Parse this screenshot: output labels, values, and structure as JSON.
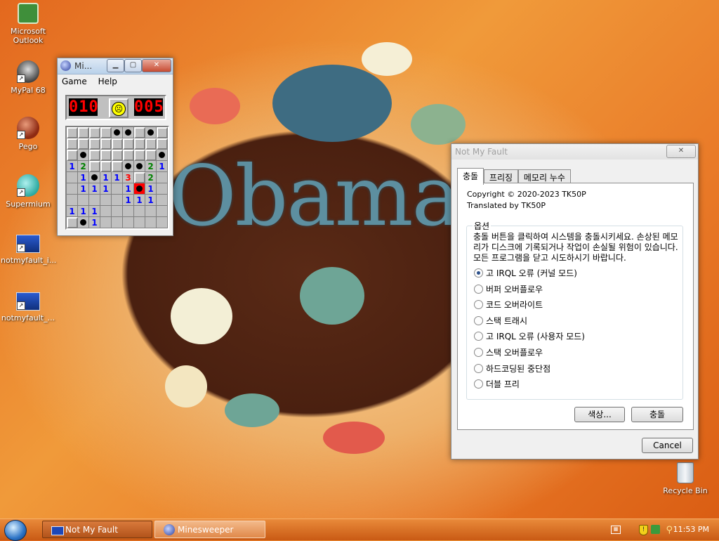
{
  "desktop": {
    "icons": [
      {
        "label": "Microsoft Outlook",
        "icon": "outlook-icon"
      },
      {
        "label": "MyPal 68",
        "icon": "mypal-icon"
      },
      {
        "label": "Pego",
        "icon": "pego-icon"
      },
      {
        "label": "Supermium",
        "icon": "supermium-icon"
      },
      {
        "label": "notmyfault_i...",
        "icon": "notmyfault-icon"
      },
      {
        "label": "notmyfault_...",
        "icon": "notmyfault-icon"
      },
      {
        "label": "Recycle Bin",
        "icon": "recycle-bin-icon"
      }
    ],
    "wallpaper_text": "Obama'C"
  },
  "minesweeper": {
    "title": "Mi...",
    "menu": [
      "Game",
      "Help"
    ],
    "mine_counter": "010",
    "timer": "005",
    "face": "sad",
    "rows": [
      [
        "c",
        "c",
        "c",
        "c",
        "m",
        "m",
        "c",
        "m",
        "c"
      ],
      [
        "c",
        "c",
        "c",
        "c",
        "c",
        "c",
        "c",
        "c",
        "c"
      ],
      [
        "c",
        "m",
        "c",
        "c",
        "c",
        "c",
        "c",
        "c",
        "m"
      ],
      [
        "1",
        "2",
        "c",
        "c",
        "c",
        "m",
        "m",
        "2",
        "1"
      ],
      [
        "",
        "1",
        "m",
        "1",
        "1",
        "3",
        "c",
        "2",
        ""
      ],
      [
        "",
        "1",
        "1",
        "1",
        "",
        "1",
        "x",
        "1",
        ""
      ],
      [
        "",
        "",
        "",
        "",
        "",
        "1",
        "1",
        "1",
        ""
      ],
      [
        "1",
        "1",
        "1",
        "",
        "",
        "",
        "",
        "",
        ""
      ],
      [
        "c",
        "m",
        "1",
        "",
        "",
        "",
        "",
        "",
        ""
      ]
    ]
  },
  "notmyfault": {
    "title": "Not My Fault",
    "tabs": [
      "충돌",
      "프리징",
      "메모리 누수"
    ],
    "copyright": "Copyright © 2020-2023 TK50P",
    "translated": "Translated by TK50P",
    "options_legend": "옵션",
    "description": "충돌 버튼을 클릭하여 시스템을 충돌시키세요. 손상된 메모리가 디스크에 기록되거나 작업이 손실될 위험이 있습니다. 모든 프로그램을 닫고 시도하시기 바랍니다.",
    "options": [
      "고 IRQL 오류 (커널 모드)",
      "버퍼 오버플로우",
      "코드 오버라이트",
      "스택 트래시",
      "고 IRQL 오류 (사용자 모드)",
      "스택 오버플로우",
      "하드코딩된 중단점",
      "더블 프리"
    ],
    "selected_index": 0,
    "color_button": "색상...",
    "crash_button": "충돌",
    "cancel_button": "Cancel"
  },
  "taskbar": {
    "items": [
      "Not My Fault",
      "Minesweeper"
    ],
    "clock": "11:53 PM"
  }
}
